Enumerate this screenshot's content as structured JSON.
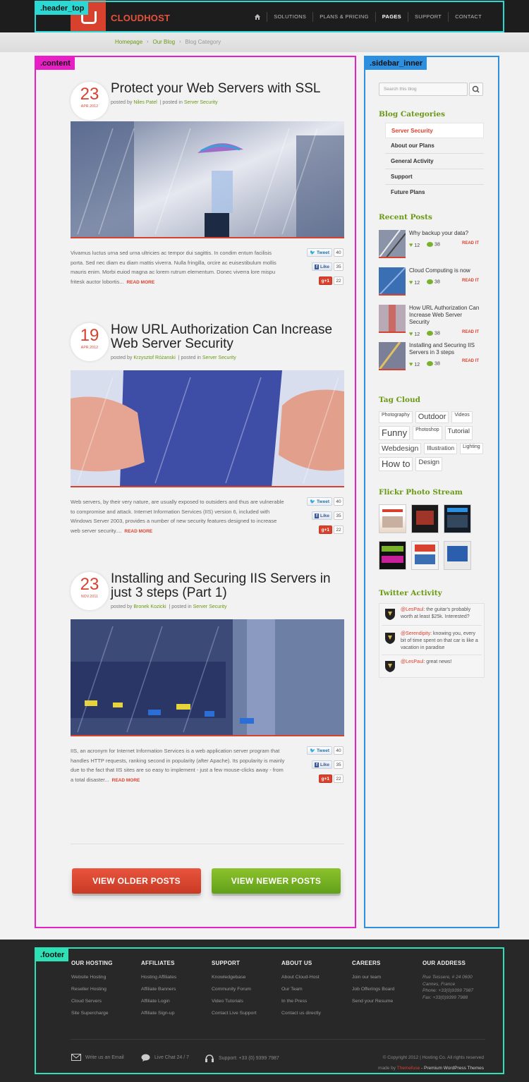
{
  "header": {
    "brand": "CLOUDHOST",
    "nav": [
      {
        "label": "SOLUTIONS"
      },
      {
        "label": "PLANS & PRICING"
      },
      {
        "label": "PAGES",
        "active": true
      },
      {
        "label": "SUPPORT"
      },
      {
        "label": "CONTACT"
      }
    ]
  },
  "breadcrumb": [
    "Homepage",
    "Our Blog",
    "Blog Category"
  ],
  "overlay_labels": {
    "header_top": ".header_top",
    "content": ".content",
    "sidebar_inner": ".sidebar_inner",
    "footer": ".footer"
  },
  "overlay_colors": {
    "header_top": "#2ad9d3",
    "content": "#e81fc4",
    "sidebar_inner": "#2d8fe0",
    "footer": "#2de0b5"
  },
  "posts": [
    {
      "day": "23",
      "month": "APR.2012",
      "title": "Protect your Web Servers with SSL",
      "meta_prefix": "posted by",
      "author": "Niles Patel",
      "meta_sep": "| posted in",
      "category": "Server Security",
      "excerpt": "Vivamus luctus urna sed urna ultricies ac tempor dui sagittis. In condim entum facilisis porta. Sed nec diam eu diam mattis viverra. Nulla fringilla, orcire ac euisestibulum mollis mauris enim. Morbi euiod magna ac lorem rutrum elementum. Donec viverra lore mispu fritesk auctor lobortis...",
      "read_more": "READ MORE",
      "tweet_label": "Tweet",
      "tweet_count": "40",
      "like_label": "Like",
      "like_count": "35",
      "plus_label": "+1",
      "plus_count": "22"
    },
    {
      "day": "19",
      "month": "APR.2012",
      "title": "How URL Authorization Can Increase Web Server Security",
      "meta_prefix": "posted by",
      "author": "Krzysztof Różanski",
      "meta_sep": "| posted in",
      "category": "Server Security",
      "excerpt": "Web servers, by their very nature, are usually exposed to outsiders and thus are vulnerable to compromise and attack. Internet Information Services (IIS) version 6, included with Windows Server 2003, provides a number of new security features designed to increase web server security....",
      "read_more": "READ MORE",
      "tweet_label": "Tweet",
      "tweet_count": "40",
      "like_label": "Like",
      "like_count": "35",
      "plus_label": "+1",
      "plus_count": "22"
    },
    {
      "day": "23",
      "month": "NOV.2011",
      "title": "Installing and Securing IIS Servers in just 3 steps (Part 1)",
      "meta_prefix": "posted by",
      "author": "Bronek Kozicki",
      "meta_sep": "| posted in",
      "category": "Server Security",
      "excerpt": "IIS, an acronym for Internet Information Services is a web application server program that handles HTTP requests, ranking second in popularity (after Apache). Its popularity is mainly due to the fact that IIS sites are so easy to implement - just a few mouse-clicks away - from a total disaster...",
      "read_more": "READ MORE",
      "tweet_label": "Tweet",
      "tweet_count": "40",
      "like_label": "Like",
      "like_count": "35",
      "plus_label": "+1",
      "plus_count": "22"
    }
  ],
  "pagination": {
    "older": "VIEW OLDER POSTS",
    "newer": "VIEW NEWER POSTS"
  },
  "sidebar": {
    "search_placeholder": "Search this blog",
    "categories_title": "Blog Categories",
    "categories": [
      {
        "label": "Server Security",
        "active": true
      },
      {
        "label": "About our Plans"
      },
      {
        "label": "General Activity"
      },
      {
        "label": "Support"
      },
      {
        "label": "Future Plans"
      }
    ],
    "recent_title": "Recent Posts",
    "recent": [
      {
        "title": "Why backup your data?",
        "likes": "12",
        "comments": "38",
        "read_more": "READ IT"
      },
      {
        "title": "Cloud Computing is now",
        "likes": "12",
        "comments": "38",
        "read_more": "READ IT"
      },
      {
        "title": "How URL Authorization Can Increase Web Server Security",
        "likes": "12",
        "comments": "38",
        "read_more": "READ IT"
      },
      {
        "title": "Installing and Securing IIS Servers in 3 steps",
        "likes": "12",
        "comments": "38",
        "read_more": "READ IT"
      }
    ],
    "tags_title": "Tag Cloud",
    "tags": [
      {
        "label": "Photography",
        "weight": 1
      },
      {
        "label": "Outdoor",
        "weight": 3
      },
      {
        "label": "Videos",
        "weight": 1
      },
      {
        "label": "Funny",
        "weight": 4
      },
      {
        "label": "Photoshop",
        "weight": 1
      },
      {
        "label": "Tutorial",
        "weight": 2
      },
      {
        "label": "Webdesign",
        "weight": 3
      },
      {
        "label": "Illustration",
        "weight": 2
      },
      {
        "label": "Lighting",
        "weight": 1
      },
      {
        "label": "How to",
        "weight": 4
      },
      {
        "label": "Design",
        "weight": 2
      }
    ],
    "flickr_title": "Flickr Photo Stream",
    "twitter_title": "Twitter Activity",
    "tweets": [
      {
        "user": "@LesPaul",
        "text": ": the guitar's probably worth at least $25k. Interested?"
      },
      {
        "user": "@Serendipity",
        "text": ": knowing you, every bit of time spent on that car is like a vacation in paradise"
      },
      {
        "user": "@LesPaul",
        "text": ": great news!"
      }
    ]
  },
  "footer": {
    "columns": [
      {
        "title": "OUR HOSTING",
        "links": [
          "Website Hosting",
          "Reseller Hosting",
          "Cloud Servers",
          "Site Supercharge"
        ]
      },
      {
        "title": "AFFILIATES",
        "links": [
          "Hosting Affiliates",
          "Affiliate Banners",
          "Affiliate Login",
          "Affiliate Sign-up"
        ]
      },
      {
        "title": "SUPPORT",
        "links": [
          "Knowledgebase",
          "Community Forum",
          "Video Tutorials",
          "Contact Live Support"
        ]
      },
      {
        "title": "ABOUT US",
        "links": [
          "About Cloud-Host",
          "Our Team",
          "In the Press",
          "Contact us directly"
        ]
      },
      {
        "title": "CAREERS",
        "links": [
          "Join our team",
          "Job Offerings Board",
          "Send your Resume"
        ]
      }
    ],
    "address": {
      "title": "OUR ADDRESS",
      "lines": [
        "Rue Teissere, # 24 0600",
        "Cannes, France",
        "Phone: +33(0)9399 7987",
        "Fax: +33(0)9399 7988"
      ]
    },
    "email": "Write us an Email",
    "chat": "Live Chat 24 / 7",
    "support": "Support: +33 (0) 9399 7987",
    "copyright": "© Copyright 2012 | Hosting Co. All rights reserved",
    "made_by_prefix": "made by",
    "made_by": "Themefuse",
    "made_by_suffix": "- Premium WordPress Themes"
  }
}
